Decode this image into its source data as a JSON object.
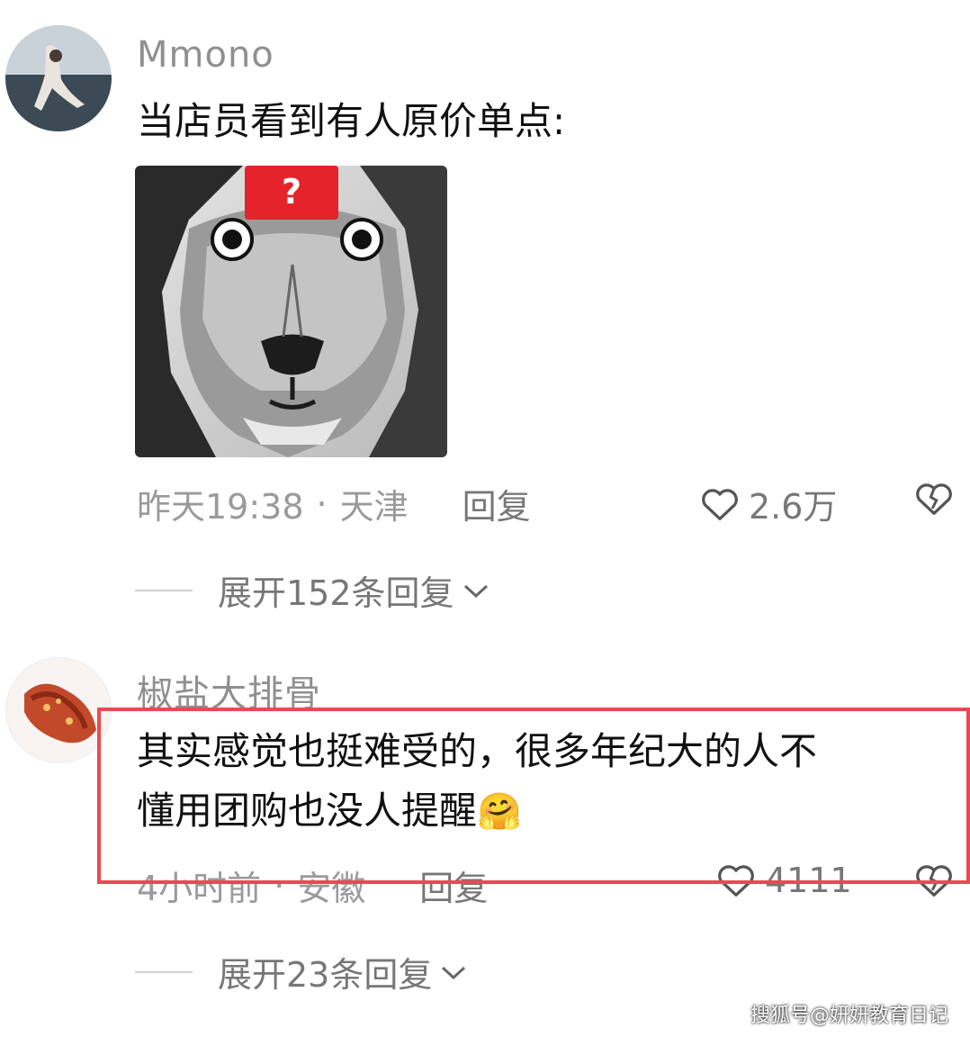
{
  "comments": [
    {
      "username": "Mmono",
      "text": "当店员看到有人原价单点:",
      "image_badge": "?",
      "time": "昨天19:38",
      "location": "天津",
      "reply_label": "回复",
      "like_count": "2.6万",
      "expand_label": "展开152条回复"
    },
    {
      "username": "椒盐大排骨",
      "text_line1": "其实感觉也挺难受的，很多年纪大的人不",
      "text_line2": "懂用团购也没人提醒",
      "emoji": "🤗",
      "time": "4小时前",
      "location": "安徽",
      "reply_label": "回复",
      "like_count": "4111",
      "expand_label": "展开23条回复"
    }
  ],
  "separator": "·",
  "watermark": "搜狐号@妍妍教育日记",
  "colors": {
    "highlight": "#e84a52",
    "meta": "#9a9a9a"
  }
}
